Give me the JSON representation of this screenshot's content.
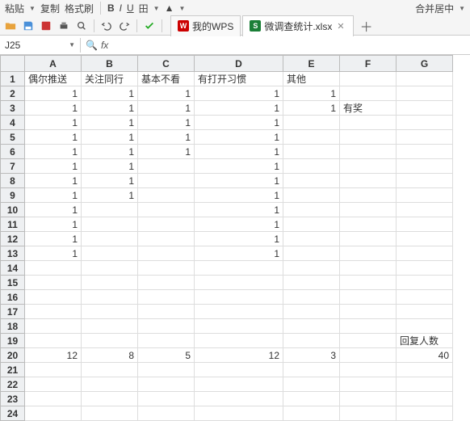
{
  "top": {
    "copy": "复制",
    "fmt": "格式刷",
    "merge": "合并居中"
  },
  "tabs": {
    "wps_label": "我的WPS",
    "file_label": "微调查统计.xlsx"
  },
  "namebox": "J25",
  "fx": "fx",
  "cols": [
    "A",
    "B",
    "C",
    "D",
    "E",
    "F",
    "G"
  ],
  "widths": [
    70,
    70,
    70,
    110,
    70,
    70,
    70
  ],
  "rows": [
    "1",
    "2",
    "3",
    "4",
    "5",
    "6",
    "7",
    "8",
    "9",
    "10",
    "11",
    "12",
    "13",
    "14",
    "15",
    "16",
    "17",
    "18",
    "19",
    "20",
    "21",
    "22",
    "23",
    "24"
  ],
  "cells": {
    "r1": {
      "A": "偶尔推送",
      "B": "关注同行",
      "C": "基本不看",
      "D": "有打开习惯",
      "E": "其他"
    },
    "r2": {
      "A": "1",
      "B": "1",
      "C": "1",
      "D": "1",
      "E": "1"
    },
    "r3": {
      "A": "1",
      "B": "1",
      "C": "1",
      "D": "1",
      "E": "1",
      "F": "有奖"
    },
    "r4": {
      "A": "1",
      "B": "1",
      "C": "1",
      "D": "1"
    },
    "r5": {
      "A": "1",
      "B": "1",
      "C": "1",
      "D": "1"
    },
    "r6": {
      "A": "1",
      "B": "1",
      "C": "1",
      "D": "1"
    },
    "r7": {
      "A": "1",
      "B": "1",
      "D": "1"
    },
    "r8": {
      "A": "1",
      "B": "1",
      "D": "1"
    },
    "r9": {
      "A": "1",
      "B": "1",
      "D": "1"
    },
    "r10": {
      "A": "1",
      "D": "1"
    },
    "r11": {
      "A": "1",
      "D": "1"
    },
    "r12": {
      "A": "1",
      "D": "1"
    },
    "r13": {
      "A": "1",
      "D": "1"
    },
    "r19": {
      "G": "回复人数"
    },
    "r20": {
      "A": "12",
      "B": "8",
      "C": "5",
      "D": "12",
      "E": "3",
      "G": "40"
    }
  }
}
